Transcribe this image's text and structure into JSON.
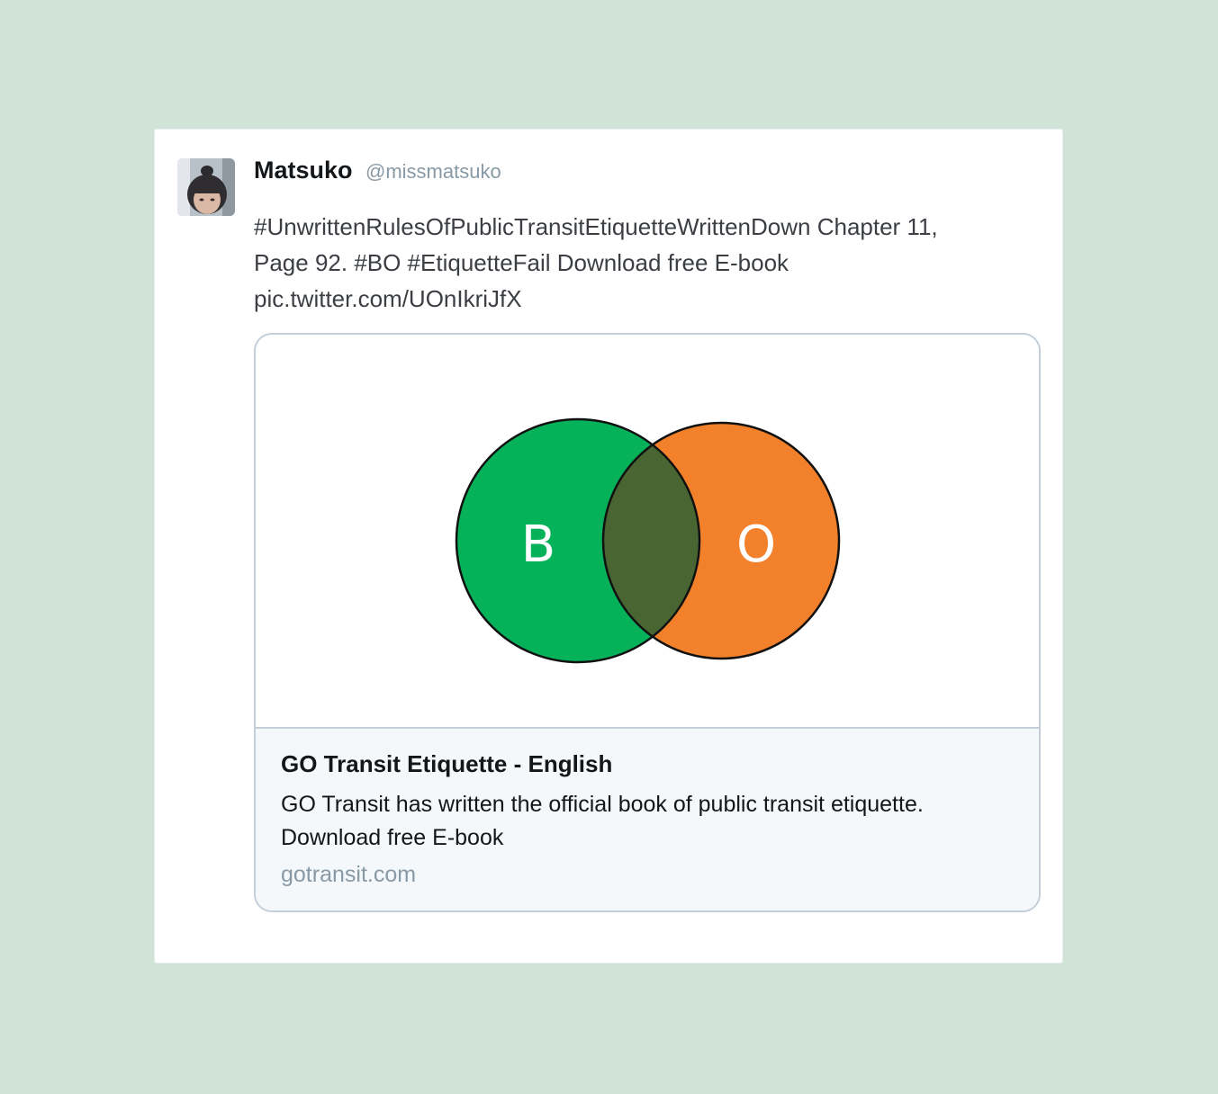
{
  "tweet": {
    "display_name": "Matsuko",
    "screen_name": "@missmatsuko",
    "text_lines": [
      "#UnwrittenRulesOfPublicTransitEtiquetteWrittenDown Chapter 11,",
      "Page 92. #BO #EtiquetteFail Download free E-book",
      "pic.twitter.com/UOnIkriJfX"
    ]
  },
  "card": {
    "image": {
      "left_letter": "B",
      "right_letter": "O",
      "colors": {
        "left": "#05b25a",
        "right": "#f3812b",
        "overlap": "#486532"
      }
    },
    "title": "GO Transit Etiquette - English",
    "description_lines": [
      "GO Transit has written the official book of public transit etiquette.",
      "Download free E-book"
    ],
    "domain": "gotransit.com"
  }
}
